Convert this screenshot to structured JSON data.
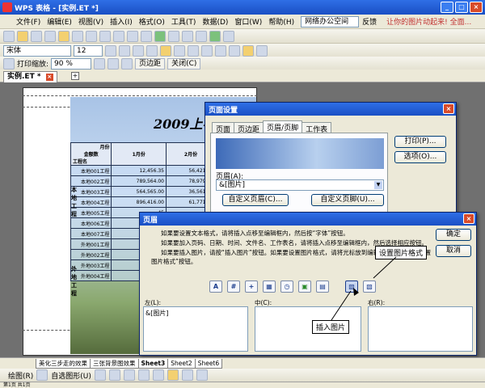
{
  "window": {
    "title": "WPS 表格 - [实例.ET *]"
  },
  "menu": {
    "items": [
      "文件(F)",
      "编辑(E)",
      "视图(V)",
      "插入(I)",
      "格式(O)",
      "工具(T)",
      "数据(D)",
      "窗口(W)",
      "帮助(H)"
    ],
    "office_space": "网络办公空间",
    "feedback": "反馈",
    "hint": "让你的图片动起来! 全面..."
  },
  "format_bar": {
    "font": "宋体",
    "size": "12"
  },
  "preview_bar": {
    "zoom_label": "打印缩放:",
    "zoom_value": "90 %",
    "margins": "页边距",
    "close": "关闭(C)"
  },
  "doc_tab": "实例.ET *",
  "sheet": {
    "title": "2009上半",
    "header_month": "月份",
    "header_proj": "工程名",
    "header_money": "金额数",
    "col1": "1月份",
    "col2": "2月份",
    "side_label": "本地工程",
    "side_label2": "外地工程",
    "rows": [
      {
        "name": "本地001工程",
        "v1": "12,456.35",
        "v2": "56,421.00"
      },
      {
        "name": "本地002工程",
        "v1": "789,564.00",
        "v2": "78,979.00"
      },
      {
        "name": "本地003工程",
        "v1": "564,565.00",
        "v2": "36,561.00"
      },
      {
        "name": "本地004工程",
        "v1": "896,416.00",
        "v2": "61,771.00"
      },
      {
        "name": "本地005工程",
        "v1": "45",
        "v2": ""
      },
      {
        "name": "本地006工程",
        "v1": "5",
        "v2": ""
      },
      {
        "name": "本地007工程",
        "v1": "4",
        "v2": ""
      },
      {
        "name": "外地001工程",
        "v1": "69",
        "v2": ""
      },
      {
        "name": "外地002工程",
        "v1": "",
        "v2": ""
      },
      {
        "name": "外地003工程",
        "v1": "",
        "v2": ""
      },
      {
        "name": "外地004工程",
        "v1": "",
        "v2": ""
      }
    ]
  },
  "page_setup": {
    "title": "页面设置",
    "tabs": [
      "页面",
      "页边距",
      "页眉/页脚",
      "工作表"
    ],
    "header_label": "页眉(A):",
    "header_value": "&[图片]",
    "custom_header": "自定义页眉(C)...",
    "custom_footer": "自定义页脚(U)...",
    "print_btn": "打印(P)...",
    "options_btn": "选项(O)..."
  },
  "header_dialog": {
    "title": "页眉",
    "instructions": [
      "如果要设置文本格式，请将插入点移至编辑框内，然后按“字体”按钮。",
      "如果要加入页码、日期、时间、文件名、工作表名，请将插入点移至编辑框内，然后选择相应按钮。",
      "如果要插入图片，请按“插入图片”按钮。如果要设置图片格式，请将光标放到编辑框中，然后按“设置图片格式”按钮。"
    ],
    "ok": "确定",
    "cancel": "取消",
    "left_label": "左(L):",
    "left_value": "&[图片]",
    "center_label": "中(C):",
    "right_label": "右(R):",
    "callout_format": "设置图片格式",
    "callout_insert": "插入图片"
  },
  "sheet_tabs": [
    "美化三步走的效果",
    "三张背景图效果",
    "Sheet3",
    "Sheet2",
    "Sheet6"
  ],
  "draw_bar": {
    "draw": "绘图(R)",
    "autoshapes": "自选图形(U)"
  },
  "status": "第1页 共1页"
}
